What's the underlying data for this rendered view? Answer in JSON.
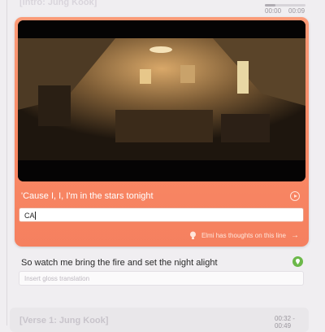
{
  "prev_section": {
    "label": "[Intro: Jung Kook]",
    "time_start": "00:00",
    "time_end": "00:09",
    "progress": 0.25
  },
  "current": {
    "lyric": "'Cause I, I, I'm in the stars tonight",
    "input_value": "CA",
    "thoughts_label": "Elmi has thoughts on this line",
    "colors": {
      "card": "#f98965",
      "video": "#0a0908"
    }
  },
  "next": {
    "lyric": "So watch me bring the fire and set the night alight",
    "placeholder": "Insert gloss translation"
  },
  "verse": {
    "label": "[Verse 1: Jung Kook]",
    "time_range": "00:32 - 00:49"
  }
}
